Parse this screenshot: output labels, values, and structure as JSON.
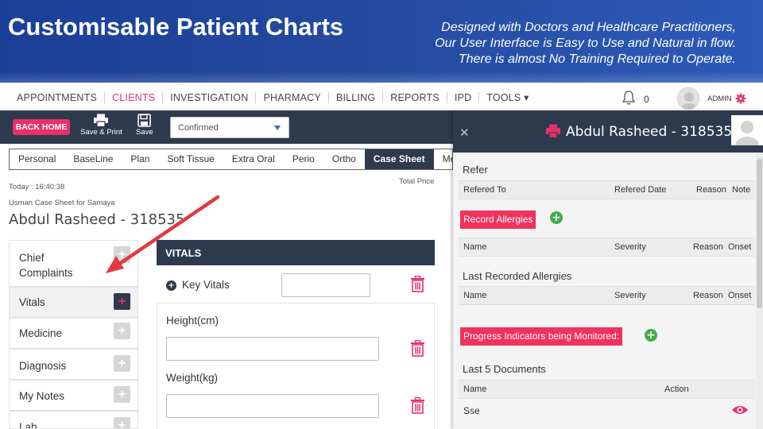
{
  "banner": {
    "title": "Customisable Patient Charts",
    "tagline_1": "Designed with Doctors and Healthcare Practitioners,",
    "tagline_2": "Our User Interface is Easy to Use and Natural in flow.",
    "tagline_3": "There is almost No Training Required to Operate."
  },
  "topnav": {
    "items": [
      "APPOINTMENTS",
      "CLIENTS",
      "INVESTIGATION",
      "PHARMACY",
      "BILLING",
      "REPORTS",
      "IPD",
      "TOOLS ▾"
    ],
    "active_index": 1,
    "notification_count": "0",
    "user_label": "ADMIN"
  },
  "toolbar": {
    "back_home": "BACK HOME",
    "save_print": "Save & Print",
    "save": "Save",
    "status_value": "Confirmed"
  },
  "tabs": [
    "Personal",
    "BaseLine",
    "Plan",
    "Soft Tissue",
    "Extra Oral",
    "Perio",
    "Ortho",
    "Case Sheet",
    "Medica"
  ],
  "tabs_active_index": 7,
  "patient": {
    "today": "Today : 16:40:38",
    "case_for": "Usman Case Sheet for Samaya",
    "name": "Abdul Rasheed - 318535",
    "total_price_label": "Total Price"
  },
  "leftmenu": {
    "items": [
      "Chief Complaints",
      "Vitals",
      "Medicine",
      "Diagnosis",
      "My Notes",
      "Lab"
    ],
    "active_index": 1
  },
  "vitals": {
    "title": "VITALS",
    "key_vitals": "Key Vitals",
    "height_label": "Height(cm)",
    "weight_label": "Weight(kg)"
  },
  "rpanel": {
    "patient_name": "Abdul Rasheed - 318535",
    "refer_title": "Refer",
    "refer_headers": [
      "Refered To",
      "Refered Date",
      "Reason",
      "Note"
    ],
    "record_allergies": "Record Allergies",
    "allergy_headers": [
      "Name",
      "Severity",
      "Reason",
      "Onset"
    ],
    "last_allergies_title": "Last Recorded Allergies",
    "progress_btn": "Progress Indicators being Monitored:",
    "last_docs_title": "Last 5 Documents",
    "doc_headers": [
      "Name",
      "Action"
    ],
    "doc_rows": [
      "Sse"
    ]
  },
  "colors": {
    "accent_pink": "#e8316a",
    "dark_navy": "#2e3a4e",
    "add_green": "#3eae48",
    "banner_blue": "#234a9e"
  }
}
